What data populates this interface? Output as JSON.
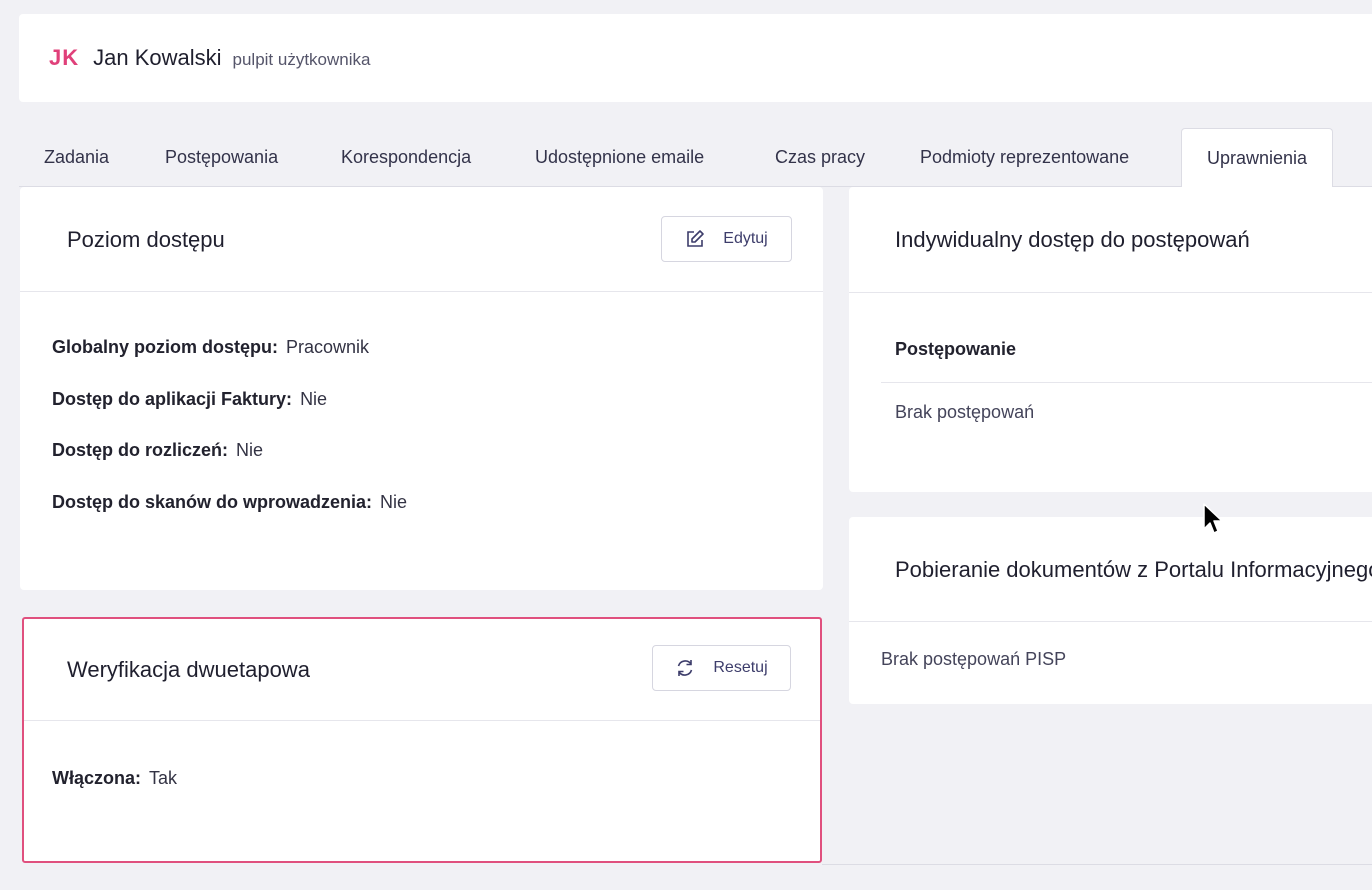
{
  "header": {
    "initials": "JK",
    "name": "Jan Kowalski",
    "subtitle": "pulpit użytkownika"
  },
  "tabs": [
    {
      "label": "Zadania"
    },
    {
      "label": "Postępowania"
    },
    {
      "label": "Korespondencja"
    },
    {
      "label": "Udostępnione emaile"
    },
    {
      "label": "Czas pracy"
    },
    {
      "label": "Podmioty reprezentowane"
    },
    {
      "label": "Uprawnienia",
      "active": true
    }
  ],
  "access_card": {
    "title": "Poziom dostępu",
    "edit_label": "Edytuj",
    "rows": [
      {
        "label": "Globalny poziom dostępu:",
        "value": "Pracownik"
      },
      {
        "label": "Dostęp do aplikacji Faktury:",
        "value": "Nie"
      },
      {
        "label": "Dostęp do rozliczeń:",
        "value": "Nie"
      },
      {
        "label": "Dostęp do skanów do wprowadzenia:",
        "value": "Nie"
      }
    ]
  },
  "twofa_card": {
    "title": "Weryfikacja dwuetapowa",
    "reset_label": "Resetuj",
    "rows": [
      {
        "label": "Włączona:",
        "value": "Tak"
      }
    ]
  },
  "individual_card": {
    "title": "Indywidualny dostęp do postępowań",
    "column_header": "Postępowanie",
    "empty_text": "Brak postępowań"
  },
  "portal_card": {
    "title": "Pobieranie dokumentów z Portalu Informacyjnego",
    "empty_text": "Brak postępowań PISP"
  },
  "colors": {
    "accent": "#e0407a",
    "highlight_border": "#e0507e",
    "background": "#f1f1f5"
  },
  "icons": {
    "edit": "edit-icon",
    "reset": "refresh-icon",
    "cursor": "mouse-cursor-icon"
  }
}
